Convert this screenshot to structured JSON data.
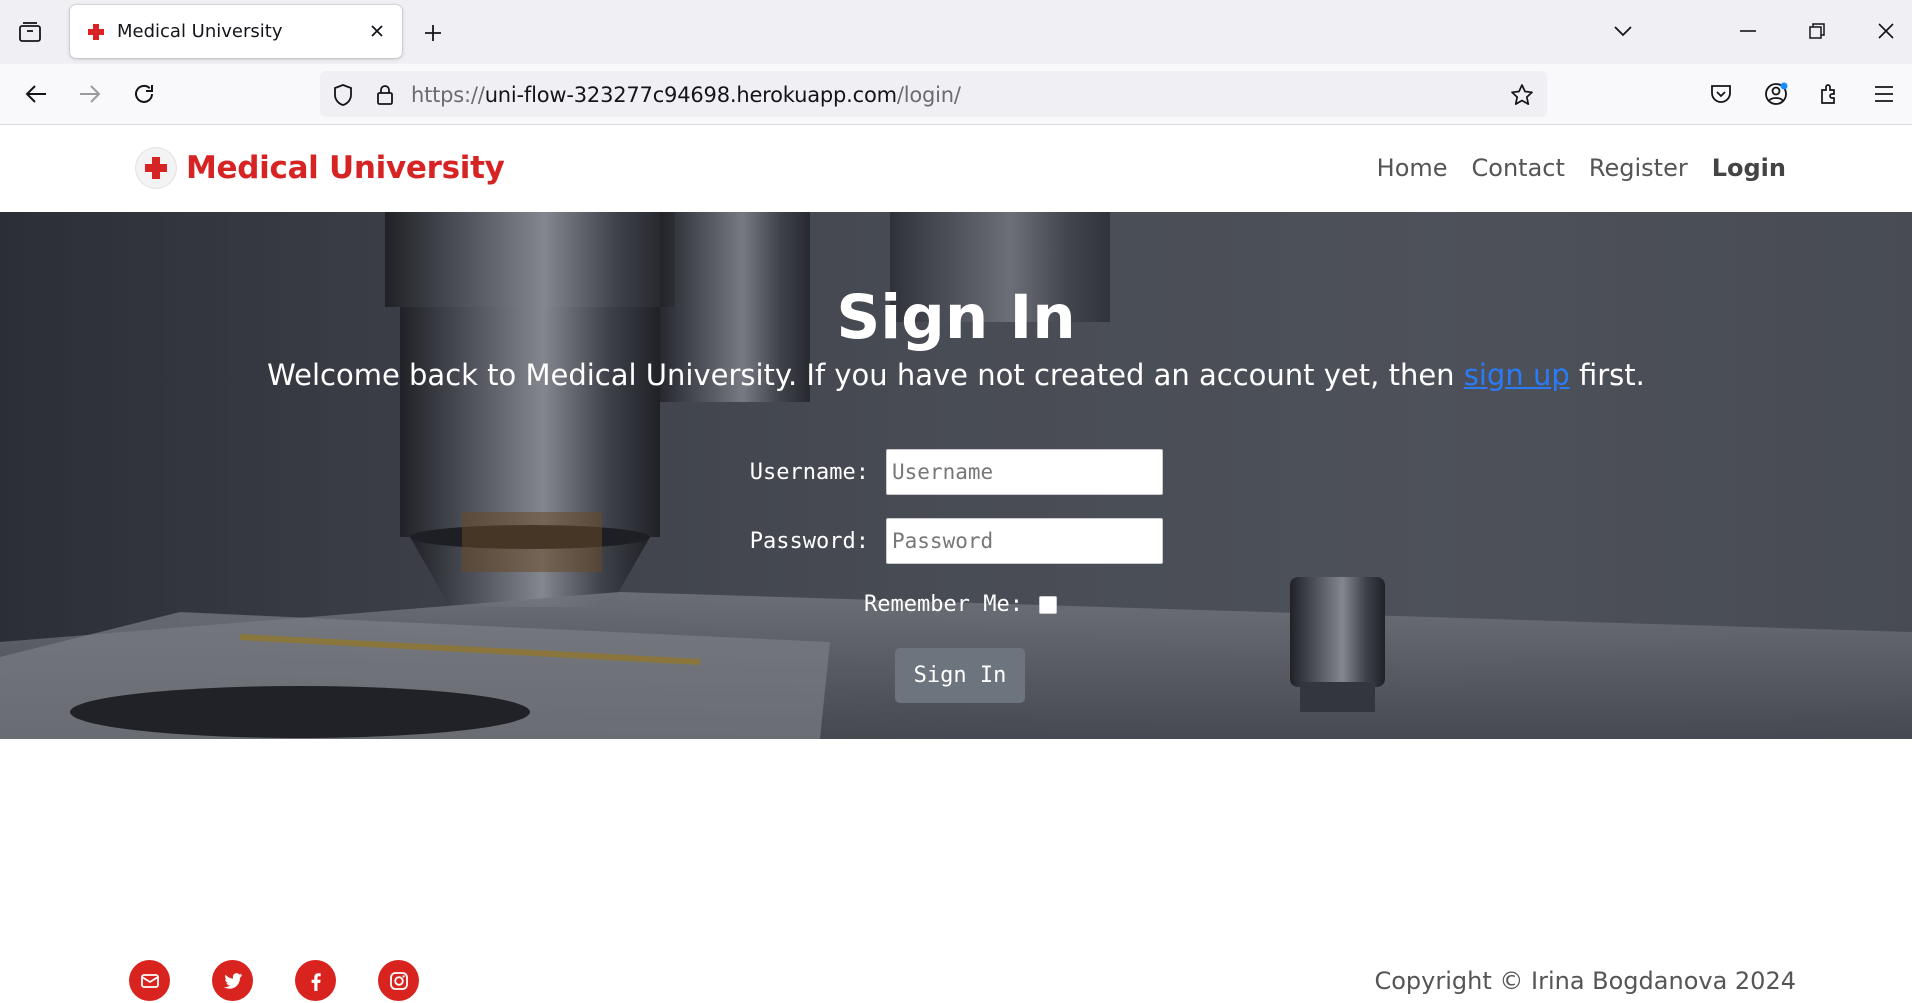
{
  "browser": {
    "tab_title": "Medical University",
    "url_prefix": "https://",
    "url_host": "uni-flow-323277c94698.herokuapp.com",
    "url_path": "/login/"
  },
  "site": {
    "brand_name": "Medical University",
    "nav": [
      {
        "label": "Home"
      },
      {
        "label": "Contact"
      },
      {
        "label": "Register"
      },
      {
        "label": "Login",
        "active": true
      }
    ]
  },
  "signin": {
    "title": "Sign In",
    "subtitle_before": "Welcome back to Medical University. If you have not created an account yet, then ",
    "subtitle_link": "sign up",
    "subtitle_after": " first.",
    "username_label": "Username:",
    "username_placeholder": "Username",
    "password_label": "Password:",
    "password_placeholder": "Password",
    "remember_label": "Remember Me:",
    "remember_checked": false,
    "submit_label": "Sign In"
  },
  "footer": {
    "social_icons": [
      "email-icon",
      "twitter-icon",
      "facebook-icon",
      "instagram-icon"
    ],
    "copyright": "Copyright © Irina Bogdanova 2024"
  },
  "colors": {
    "brand_red": "#d62424",
    "link_blue": "#2a7bf5",
    "button_gray": "#6c757d"
  }
}
